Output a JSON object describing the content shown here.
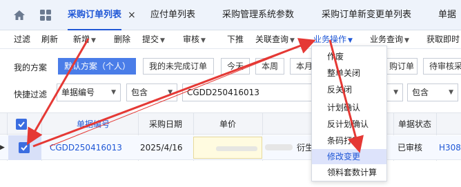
{
  "tabs": [
    {
      "label": "采购订单列表",
      "active": true,
      "closable": true
    },
    {
      "label": "应付单列表"
    },
    {
      "label": "采购管理系统参数"
    },
    {
      "label": "采购订单新变更单列表"
    },
    {
      "label": "单据"
    }
  ],
  "toolbar": {
    "items": [
      "过滤",
      "刷新",
      "新增",
      "删除",
      "提交",
      "审核",
      "下推",
      "关联查询",
      "业务操作",
      "业务查询",
      "获取即时"
    ]
  },
  "scheme": {
    "label": "我的方案",
    "items": [
      "默认方案（个人）",
      "我的未完成订单",
      "今天",
      "本周",
      "本月",
      "购订单",
      "待审核采"
    ]
  },
  "filter": {
    "label": "快捷过滤",
    "field": "单据编号",
    "op": "包含",
    "value": "CGDD250416013",
    "op2": "包含"
  },
  "grid": {
    "headers": [
      "单据编号",
      "采购日期",
      "单价",
      "单据状态"
    ],
    "rows": [
      {
        "order_no": "CGDD250416013",
        "date": "2025/4/16",
        "text": "衍生",
        "status": "已审核",
        "code": "H308-"
      }
    ]
  },
  "menu": {
    "items": [
      "作废",
      "整单关闭",
      "反关闭",
      "计划确认",
      "反计划确认",
      "条码打印",
      "修改变更",
      "领料套数计算"
    ],
    "selected_index": 6
  },
  "colors": {
    "accent": "#1f57d6",
    "arrow": "#e53935",
    "menu_highlight": "#dde3fb"
  }
}
